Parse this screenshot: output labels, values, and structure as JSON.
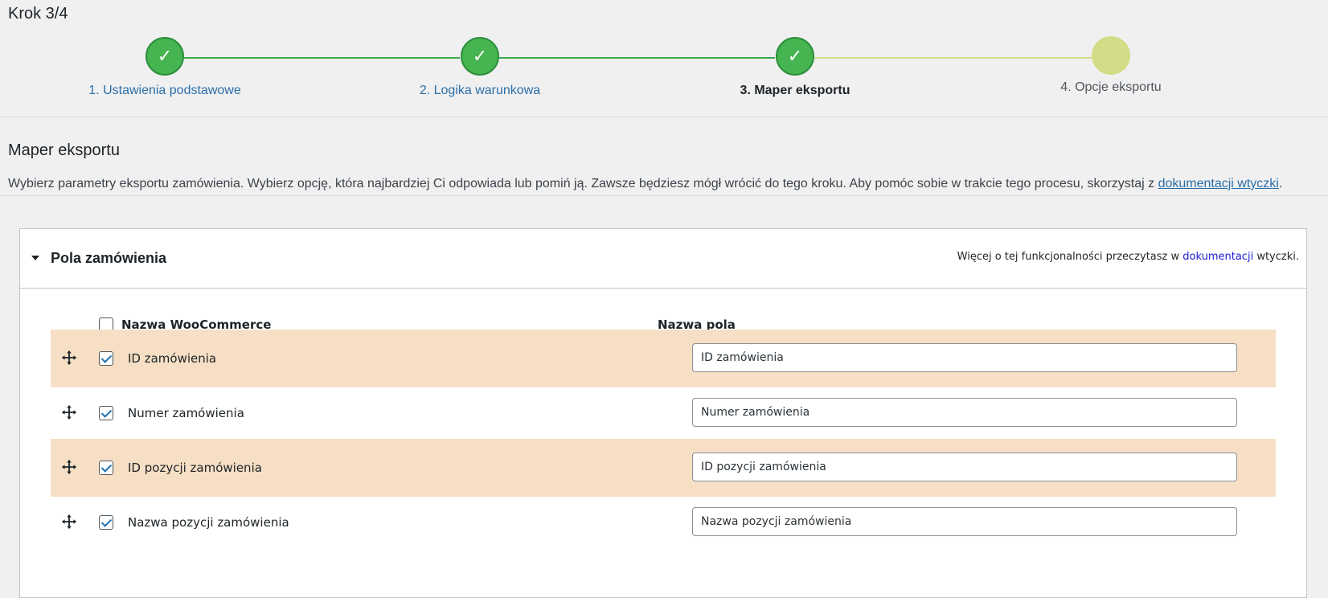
{
  "page": {
    "step_title": "Krok 3/4"
  },
  "stepper": {
    "steps": [
      {
        "label": "1. Ustawienia podstawowe",
        "state": "done",
        "check": "✓"
      },
      {
        "label": "2. Logika warunkowa",
        "state": "done",
        "check": "✓"
      },
      {
        "label": "3. Maper eksportu",
        "state": "current",
        "check": "✓"
      },
      {
        "label": "4. Opcje eksportu",
        "state": "pending",
        "check": ""
      }
    ],
    "colors": {
      "done": "#46b450",
      "pending": "#d3dc86"
    }
  },
  "section": {
    "title": "Maper eksportu",
    "description": "Wybierz parametry eksportu zamówienia. Wybierz opcję, która najbardziej Ci odpowiada lub pomiń ją. Zawsze będziesz mógł wrócić do tego kroku. Aby pomóc sobie w trakcie tego procesu, skorzystaj z ",
    "doc_link": "dokumentacji wtyczki",
    "description_end": "."
  },
  "panel": {
    "title": "Pola zamówienia",
    "note_before": "Więcej o tej funkcjonalności przeczytasz w ",
    "note_link": "dokumentacji",
    "note_after": " wtyczki.",
    "col_woocommerce": "Nazwa WooCommerce",
    "col_field": "Nazwa pola",
    "rows": [
      {
        "label": "ID zamówienia",
        "value": "ID zamówienia",
        "checked": true
      },
      {
        "label": "Numer zamówienia",
        "value": "Numer zamówienia",
        "checked": true
      },
      {
        "label": "ID pozycji zamówienia",
        "value": "ID pozycji zamówienia",
        "checked": true
      },
      {
        "label": "Nazwa pozycji zamówienia",
        "value": "Nazwa pozycji zamówienia",
        "checked": true
      }
    ],
    "row_highlight_color": "#f6dfc4"
  },
  "icons": {
    "move": "move-icon",
    "caret": "caret-down-icon",
    "check": "checkmark-icon"
  }
}
